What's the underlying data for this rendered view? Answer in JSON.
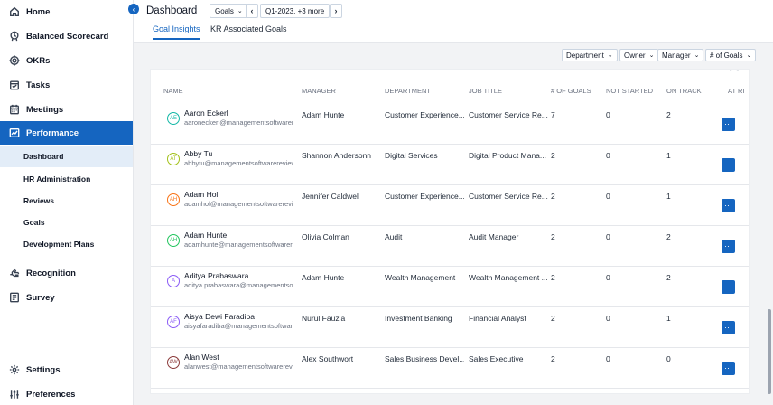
{
  "sidebar": {
    "top": [
      {
        "label": "Home",
        "icon": "home-icon",
        "active": false
      },
      {
        "label": "Balanced Scorecard",
        "icon": "scorecard-icon",
        "active": false
      },
      {
        "label": "OKRs",
        "icon": "target-icon",
        "active": false
      },
      {
        "label": "Tasks",
        "icon": "tasks-icon",
        "active": false
      },
      {
        "label": "Meetings",
        "icon": "calendar-icon",
        "active": false
      },
      {
        "label": "Performance",
        "icon": "performance-icon",
        "active": true
      }
    ],
    "sub": [
      {
        "label": "Dashboard",
        "active": true
      },
      {
        "label": "HR Administration",
        "active": false
      },
      {
        "label": "Reviews",
        "active": false
      },
      {
        "label": "Goals",
        "active": false
      },
      {
        "label": "Development Plans",
        "active": false
      }
    ],
    "bottom": [
      {
        "label": "Recognition",
        "icon": "recognition-icon"
      },
      {
        "label": "Survey",
        "icon": "survey-icon"
      }
    ],
    "footer": [
      {
        "label": "Settings",
        "icon": "gear-icon"
      },
      {
        "label": "Preferences",
        "icon": "sliders-icon"
      }
    ]
  },
  "header": {
    "title": "Dashboard",
    "goals_dropdown": "Goals",
    "period": "Q1-2023, +3 more",
    "tabs": [
      "Goal Insights",
      "KR Associated Goals"
    ]
  },
  "filters": [
    "Department",
    "Owner",
    "Manager",
    "# of Goals"
  ],
  "table": {
    "headers": [
      "NAME",
      "MANAGER",
      "DEPARTMENT",
      "JOB TITLE",
      "# OF GOALS",
      "NOT STARTED",
      "ON TRACK",
      "AT RI"
    ],
    "rows": [
      {
        "initials": "AE",
        "color": "#14b8a6",
        "name": "Aaron Eckerl",
        "email": "aaroneckerl@managementsoftwarereview.com",
        "manager": "Adam Hunte",
        "department": "Customer Experience...",
        "job": "Customer Service Re...",
        "goals": "7",
        "not_started": "0",
        "on_track": "2"
      },
      {
        "initials": "AT",
        "color": "#a3c11a",
        "name": "Abby Tu",
        "email": "abbytu@managementsoftwarereview.com",
        "manager": "Shannon Andersonn",
        "department": "Digital Services",
        "job": "Digital Product Mana...",
        "goals": "2",
        "not_started": "0",
        "on_track": "1"
      },
      {
        "initials": "AH",
        "color": "#f97316",
        "name": "Adam Hol",
        "email": "adamhol@managementsoftwarereview.com",
        "manager": "Jennifer Caldwel",
        "department": "Customer Experience...",
        "job": "Customer Service Re...",
        "goals": "2",
        "not_started": "0",
        "on_track": "1"
      },
      {
        "initials": "AH",
        "color": "#22c55e",
        "name": "Adam Hunte",
        "email": "adamhunte@managementsoftwarereview.com",
        "manager": "Olivia Colman",
        "department": "Audit",
        "job": "Audit Manager",
        "goals": "2",
        "not_started": "0",
        "on_track": "2"
      },
      {
        "initials": "A",
        "color": "#8b5cf6",
        "name": "Aditya Prabaswara",
        "email": "aditya.prabaswara@managementsoftwarereview.com",
        "manager": "Adam Hunte",
        "department": "Wealth Management",
        "job": "Wealth Management ...",
        "goals": "2",
        "not_started": "0",
        "on_track": "2"
      },
      {
        "initials": "AF",
        "color": "#8b5cf6",
        "name": "Aisya Dewi Faradiba",
        "email": "aisyafaradiba@managementsoftwarereview.com",
        "manager": "Nurul Fauzia",
        "department": "Investment Banking",
        "job": "Financial Analyst",
        "goals": "2",
        "not_started": "0",
        "on_track": "1"
      },
      {
        "initials": "AW",
        "color": "#8b3a3a",
        "name": "Alan West",
        "email": "alanwest@managementsoftwarereview.com",
        "manager": "Alex Southwort",
        "department": "Sales Business Devel...",
        "job": "Sales Executive",
        "goals": "2",
        "not_started": "0",
        "on_track": "0"
      }
    ],
    "action_label": "···"
  },
  "colors": {
    "accent": "#1565c0",
    "sidebar_active_sub": "#e3edf8"
  }
}
